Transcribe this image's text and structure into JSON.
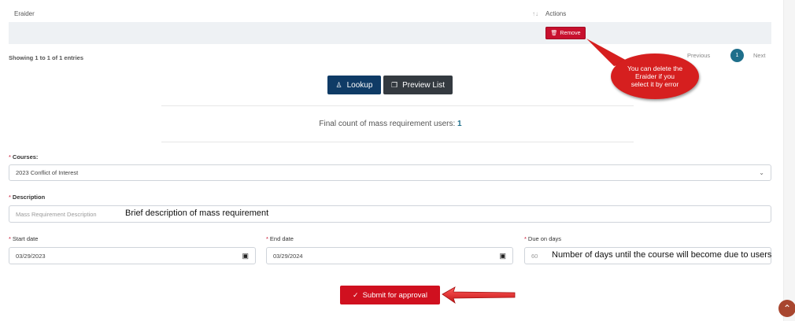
{
  "table": {
    "header_col1": "Eraider",
    "sort_icon": "↑↓",
    "header_actions": "Actions",
    "remove_label": "Remove",
    "showing": "Showing 1 to 1 of 1 entries"
  },
  "pagination": {
    "previous": "Previous",
    "current": "1",
    "next": "Next"
  },
  "buttons": {
    "lookup": "Lookup",
    "preview": "Preview List",
    "submit": "Submit for approval"
  },
  "final_count": {
    "label": "Final count of mass requirement users: ",
    "value": "1"
  },
  "form": {
    "courses_label": "Courses:",
    "courses_value": "2023 Conflict of Interest",
    "description_label": "Description",
    "description_placeholder": "Mass Requirement Description",
    "start_label": "Start date",
    "start_value": "03/29/2023",
    "end_label": "End date",
    "end_value": "03/29/2024",
    "due_label": "Due on days",
    "due_value": "60"
  },
  "annotations": {
    "description_note": "Brief description of mass requirement",
    "due_note": "Number of days until the course will become due to users",
    "callout": "You can delete the Eraider if you select it by error"
  },
  "colors": {
    "remove": "#c8102e",
    "lookup": "#0f3b66",
    "preview": "#343a40",
    "submit": "#d0101f",
    "accent": "#1f6f8b"
  }
}
